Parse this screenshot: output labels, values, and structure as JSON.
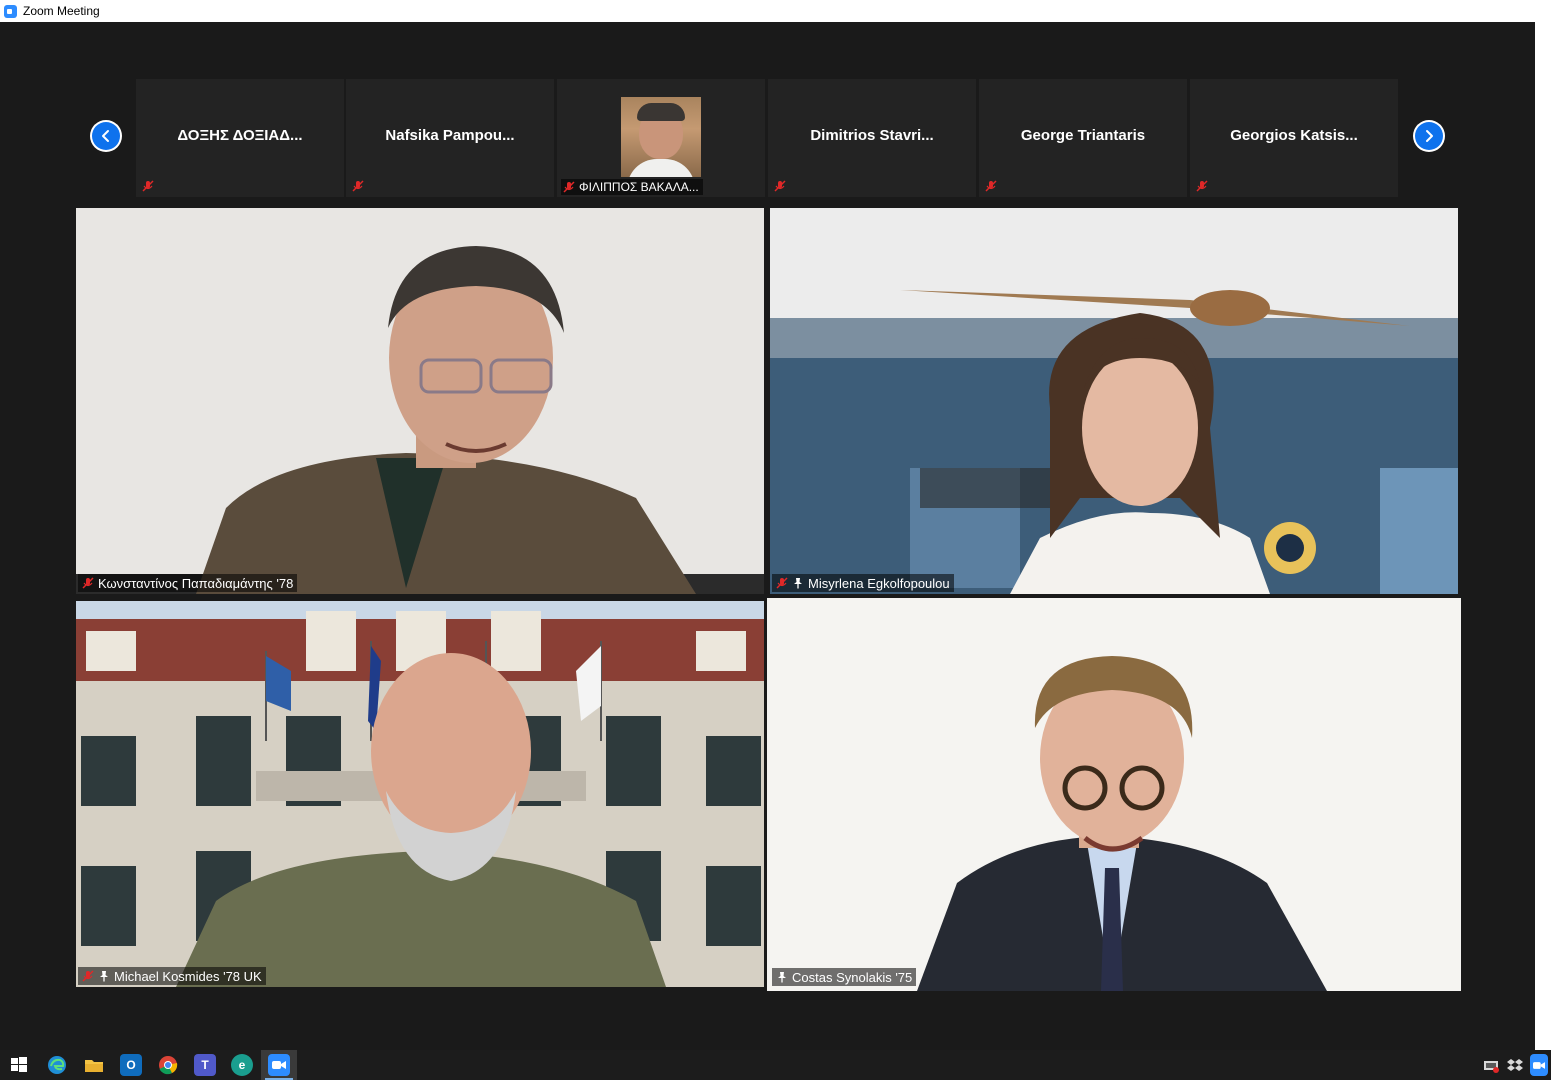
{
  "window": {
    "title": "Zoom Meeting"
  },
  "strip": {
    "prev_icon": "chevron-left-icon",
    "next_icon": "chevron-right-icon",
    "participants": [
      {
        "name": "ΔΟΞΗΣ ΔΟΞΙΑΔ...",
        "muted": true
      },
      {
        "name": "Nafsika Pampou...",
        "muted": true
      },
      {
        "name": "ΦΙΛΙΠΠΟΣ ΒΑΚΑΛΑ...",
        "muted": true,
        "has_video": true
      },
      {
        "name": "Dimitrios Stavri...",
        "muted": true
      },
      {
        "name": "George Triantaris",
        "muted": true
      },
      {
        "name": "Georgios Katsis...",
        "muted": true
      }
    ]
  },
  "gallery": {
    "tiles": [
      {
        "name": "Κωνσταντίνος Παπαδιαμάντης '78",
        "muted": true,
        "pinned": false
      },
      {
        "name": "Misyrlena Egkolfopoulou",
        "muted": true,
        "pinned": true
      },
      {
        "name": "Michael Kosmides '78 UK",
        "muted": true,
        "pinned": true
      },
      {
        "name": "Costas Synolakis '75",
        "muted": false,
        "pinned": true,
        "active_speaker": true
      }
    ]
  },
  "taskbar": {
    "icons": [
      "windows-start-icon",
      "edge-icon",
      "file-explorer-icon",
      "outlook-icon",
      "chrome-icon",
      "teams-icon",
      "edge-legacy-icon",
      "zoom-icon"
    ],
    "active_app": "zoom-icon",
    "tray_icons": [
      "network-icon",
      "dropbox-icon",
      "zoom-tray-icon"
    ]
  },
  "colors": {
    "accent": "#0e72ed",
    "active_speaker_border": "#d6e35f",
    "background": "#1a1a1a",
    "mute_red": "#e02828"
  }
}
